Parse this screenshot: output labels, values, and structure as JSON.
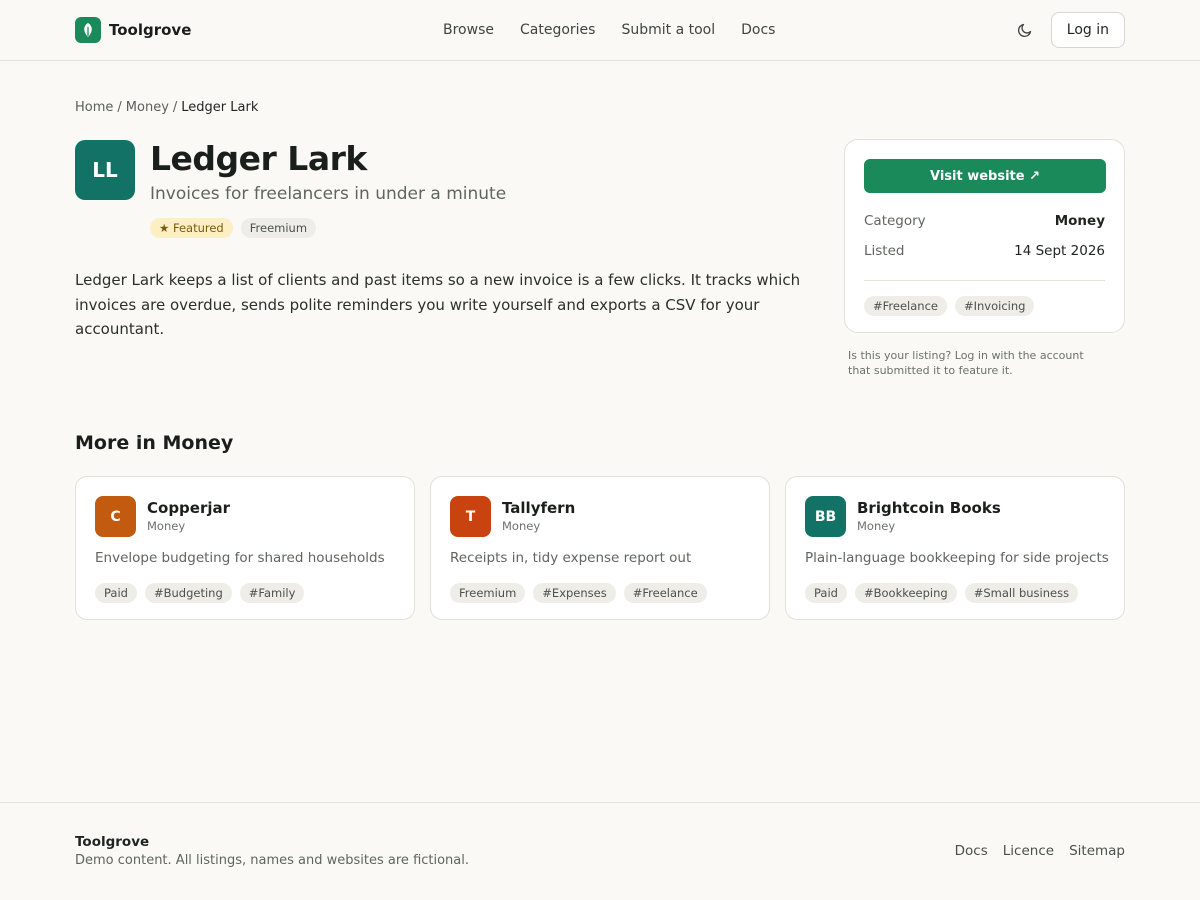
{
  "header": {
    "brand": "Toolgrove",
    "nav": [
      "Browse",
      "Categories",
      "Submit a tool",
      "Docs"
    ],
    "login_label": "Log in"
  },
  "breadcrumb": {
    "home": "Home",
    "category": "Money",
    "current": "Ledger Lark"
  },
  "tool": {
    "initials": "LL",
    "name": "Ledger Lark",
    "tagline": "Invoices for freelancers in under a minute",
    "badges": [
      "★ Featured",
      "Freemium"
    ],
    "description": "Ledger Lark keeps a list of clients and past items so a new invoice is a few clicks. It tracks which invoices are overdue, sends polite reminders you write yourself and exports a CSV for your accountant.",
    "icon_color": "#137266"
  },
  "side": {
    "visit_label": "Visit website ↗",
    "category_label": "Category",
    "category_value": "Money",
    "listed_label": "Listed",
    "listed_value": "14 Sept 2026",
    "tags": [
      "#Freelance",
      "#Invoicing"
    ],
    "note": "Is this your listing? Log in with the account that submitted it to feature it."
  },
  "more": {
    "title": "More in Money",
    "cards": [
      {
        "initials": "C",
        "name": "Copperjar",
        "category": "Money",
        "description": "Envelope budgeting for shared households",
        "tags": [
          "Paid",
          "#Budgeting",
          "#Family"
        ],
        "color": "#c25a0f"
      },
      {
        "initials": "T",
        "name": "Tallyfern",
        "category": "Money",
        "description": "Receipts in, tidy expense report out",
        "tags": [
          "Freemium",
          "#Expenses",
          "#Freelance"
        ],
        "color": "#c8430f"
      },
      {
        "initials": "BB",
        "name": "Brightcoin Books",
        "category": "Money",
        "description": "Plain-language bookkeeping for side projects",
        "tags": [
          "Paid",
          "#Bookkeeping",
          "#Small business"
        ],
        "color": "#137266"
      }
    ]
  },
  "footer": {
    "brand": "Toolgrove",
    "note": "Demo content. All listings, names and websites are fictional.",
    "links": [
      "Docs",
      "Licence",
      "Sitemap"
    ]
  },
  "colors": {
    "accent": "#1b8a5a",
    "background": "#faf9f6"
  }
}
